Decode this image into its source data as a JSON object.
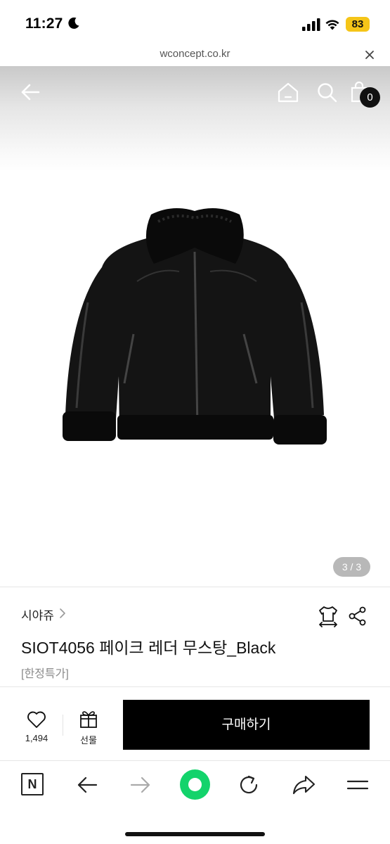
{
  "status_bar": {
    "time": "11:27",
    "battery": "83",
    "icons": [
      "moon-icon",
      "signal-icon",
      "wifi-icon",
      "battery-icon"
    ]
  },
  "browser": {
    "url": "wconcept.co.kr",
    "close_icon": "close-icon"
  },
  "product_nav": {
    "icons": [
      "back-arrow-icon",
      "home-icon",
      "search-icon",
      "cart-icon"
    ],
    "cart_count": "0"
  },
  "gallery": {
    "page_indicator": "3 / 3",
    "image": "black-shearling-jacket-photo"
  },
  "product": {
    "brand": "시야쥬",
    "name": "SIOT4056 페이크 레더 무스탕_Black",
    "tag": "[한정특가]"
  },
  "actions": {
    "wish_count": "1,494",
    "gift_label": "선물",
    "buy_label": "구매하기"
  },
  "toolbar": {
    "n_label": "N",
    "icons": [
      "naver-n-icon",
      "back-icon",
      "forward-icon",
      "green-dot-icon",
      "reload-icon",
      "share-icon",
      "menu-icon"
    ],
    "accent_color": "#13d36b"
  }
}
